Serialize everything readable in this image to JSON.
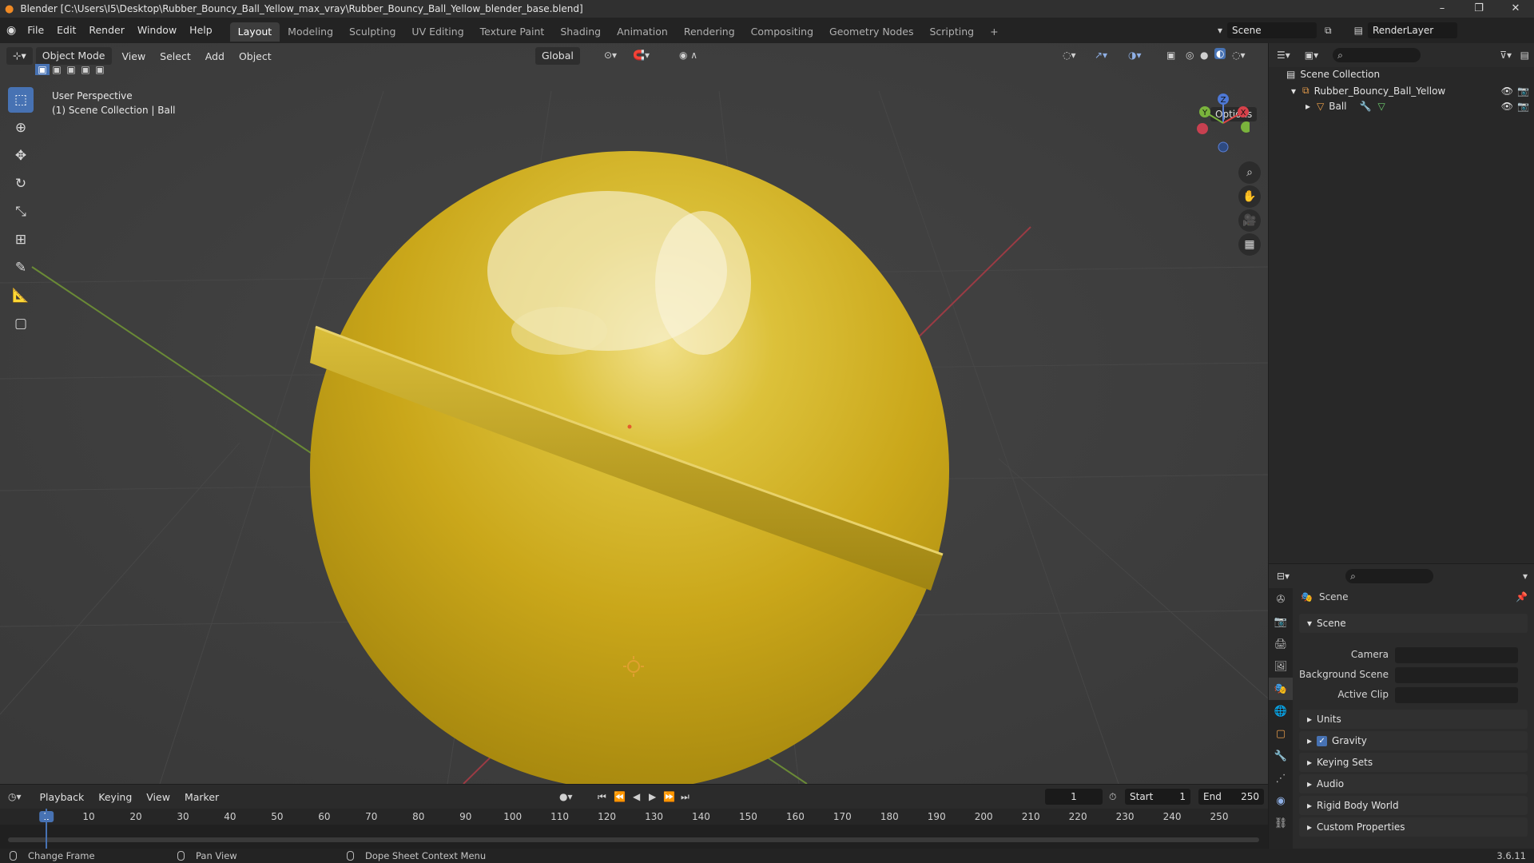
{
  "titlebar": {
    "title": "Blender [C:\\Users\\I5\\Desktop\\Rubber_Bouncy_Ball_Yellow_max_vray\\Rubber_Bouncy_Ball_Yellow_blender_base.blend]",
    "controls": [
      "–",
      "❐",
      "✕"
    ]
  },
  "menus": [
    "File",
    "Edit",
    "Render",
    "Window",
    "Help"
  ],
  "workspaces": [
    "Layout",
    "Modeling",
    "Sculpting",
    "UV Editing",
    "Texture Paint",
    "Shading",
    "Animation",
    "Rendering",
    "Compositing",
    "Geometry Nodes",
    "Scripting",
    "+"
  ],
  "active_workspace": "Layout",
  "scene_field": "Scene",
  "renderlayer_field": "RenderLayer",
  "viewport_header": {
    "mode": "Object Mode",
    "menus": [
      "View",
      "Select",
      "Add",
      "Object"
    ],
    "orientation": "Global",
    "options": "Options"
  },
  "viewport": {
    "line1": "User Perspective",
    "line2": "(1) Scene Collection | Ball"
  },
  "gizmo": {
    "x": "X",
    "y": "Y",
    "z": "Z"
  },
  "outliner": {
    "root": "Scene Collection",
    "collection": "Rubber_Bouncy_Ball_Yellow",
    "object": "Ball"
  },
  "properties": {
    "title": "Scene",
    "section": "Scene",
    "camera_label": "Camera",
    "bg_label": "Background Scene",
    "clip_label": "Active Clip",
    "panels": [
      "Units",
      "Gravity",
      "Keying Sets",
      "Audio",
      "Rigid Body World",
      "Custom Properties"
    ],
    "gravity_checked": true
  },
  "timeline": {
    "menus": [
      "Playback",
      "Keying",
      "View",
      "Marker"
    ],
    "current_frame": "1",
    "start_label": "Start",
    "start": "1",
    "end_label": "End",
    "end": "250",
    "ticks": [
      "1",
      "10",
      "20",
      "30",
      "40",
      "50",
      "60",
      "70",
      "80",
      "90",
      "100",
      "110",
      "120",
      "130",
      "140",
      "150",
      "160",
      "170",
      "180",
      "190",
      "200",
      "210",
      "220",
      "230",
      "240",
      "250"
    ]
  },
  "statusbar": {
    "a": "Change Frame",
    "b": "Pan View",
    "c": "Dope Sheet Context Menu",
    "version": "3.6.11"
  },
  "colors": {
    "accent": "#4772b3",
    "ball": "#d4b21a",
    "bg": "#3b3b3b"
  }
}
